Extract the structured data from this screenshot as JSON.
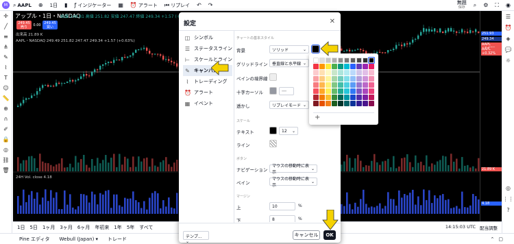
{
  "topbar": {
    "avatar": "M",
    "symbol": "AAPL",
    "indicators": "インジケーター",
    "alert": "アラート",
    "replay": "リプレイ",
    "layout_name": "無題",
    "layout_sub": "保存"
  },
  "chart_header": {
    "title": "アップル・1日・NASDAQ",
    "ohlc": "始値 249.81 高値 251.82 安値 247.47 終値 249.34 +1.57 (+0.63%)",
    "sell_price": "249.45",
    "sell_label": "売り",
    "spread": "0.00",
    "buy_price": "249.45",
    "buy_label": "買い",
    "legend_line": "AAPL・NASDAQ 249.49 251.82 247.47 249.34 +1.57 (+0.63%)",
    "volume_label": "出来高 21.89 K",
    "volume_pane_label": "24H Vol. close 4.18"
  },
  "price_axis": {
    "tag1": "251.93",
    "tag2": "249.34",
    "tag3": "AAPL +0.32%",
    "tag4": "AAPL +0.32%",
    "volume_tag": "21.89 K",
    "vol_tag2": "4.18",
    "timestamp": "14:15:03 UTC",
    "adjust": "配当調整"
  },
  "ranges": [
    "1日",
    "5日",
    "1ヶ月",
    "3ヶ月",
    "6ヶ月",
    "年初来",
    "1年",
    "5年",
    "すべて"
  ],
  "footer": {
    "tabs": [
      "Pine エディタ",
      "Webull (Japan) ▾",
      "トレード"
    ]
  },
  "dialog": {
    "title": "設定",
    "nav": [
      {
        "label": "シンボル",
        "icon": "symbol-icon"
      },
      {
        "label": "ステータスライン",
        "icon": "status-line-icon"
      },
      {
        "label": "スケールとライン",
        "icon": "scale-icon"
      },
      {
        "label": "キャンバス",
        "icon": "canvas-brush-icon"
      },
      {
        "label": "トレーディング",
        "icon": "trading-icon"
      },
      {
        "label": "アラート",
        "icon": "alarm-clock-icon"
      },
      {
        "label": "イベント",
        "icon": "calendar-icon"
      }
    ],
    "sections": {
      "chart_style": "チャートの基本スタイル",
      "scale": "スケール",
      "buttons": "ボタン",
      "margins": "マージン"
    },
    "rows": {
      "background_label": "背景",
      "background_value": "ソリッド",
      "grid_label": "グリッドライン",
      "grid_value": "垂直線と水平線",
      "pane_sep_label": "ペインの境界線",
      "crosshair_label": "十字カーソル",
      "watermark_label": "透かし",
      "watermark_value": "リプレイモード",
      "text_label": "テキスト",
      "text_size": "12",
      "line_label": "ライン",
      "nav_label": "ナビゲーション",
      "nav_value": "マウスの移動時に表示",
      "pane_label": "ペイン",
      "pane_value": "マウスの移動時に表示",
      "top_label": "上",
      "top_value": "10",
      "bottom_label": "下",
      "bottom_value": "8",
      "unit": "%"
    },
    "template_label": "テンプ...",
    "cancel_label": "キャンセル",
    "ok_label": "OK"
  },
  "colors": {
    "background_swatch": "#000000",
    "arrow": "#f5d200",
    "up": "#26a69a",
    "down": "#ef5350"
  }
}
